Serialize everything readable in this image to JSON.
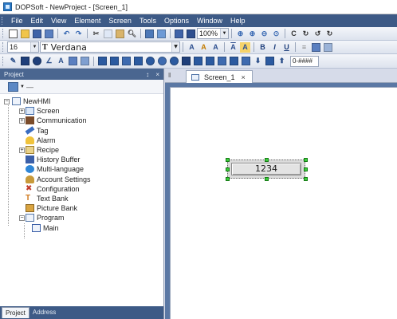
{
  "window": {
    "title": "DOPSoft - NewProject - [Screen_1]"
  },
  "menu": [
    "File",
    "Edit",
    "View",
    "Element",
    "Screen",
    "Tools",
    "Options",
    "Window",
    "Help"
  ],
  "toolbar": {
    "zoom": "100%",
    "font_size": "16",
    "font_name": "Verdana",
    "font_icon": "T",
    "format_value": "0-####",
    "text_buttons": {
      "btn1": "A",
      "btn2": "A",
      "btn3": "A",
      "btn4": "A",
      "btn5": "A",
      "bold": "B",
      "italic": "I",
      "underline": "U"
    }
  },
  "project_panel": {
    "title": "Project",
    "pin": "p",
    "close": "×",
    "tree": {
      "root": "NewHMI",
      "items": [
        {
          "label": "Screen",
          "icon": "screen-icon",
          "expandable": true
        },
        {
          "label": "Communication",
          "icon": "communication-icon",
          "expandable": true
        },
        {
          "label": "Tag",
          "icon": "tag-icon",
          "expandable": false
        },
        {
          "label": "Alarm",
          "icon": "alarm-icon",
          "expandable": false
        },
        {
          "label": "Recipe",
          "icon": "recipe-icon",
          "expandable": true
        },
        {
          "label": "History Buffer",
          "icon": "history-buffer-icon",
          "expandable": false
        },
        {
          "label": "Multi-language",
          "icon": "multi-language-icon",
          "expandable": false
        },
        {
          "label": "Account Settings",
          "icon": "account-settings-icon",
          "expandable": false
        },
        {
          "label": "Configuration",
          "icon": "configuration-icon",
          "expandable": false
        },
        {
          "label": "Text Bank",
          "icon": "text-bank-icon",
          "expandable": false
        },
        {
          "label": "Picture Bank",
          "icon": "picture-bank-icon",
          "expandable": false
        },
        {
          "label": "Program",
          "icon": "program-icon",
          "expandable": true
        }
      ],
      "program_children": [
        "Main"
      ]
    },
    "tabs": [
      "Project",
      "Address"
    ]
  },
  "document": {
    "tab_label": "Screen_1",
    "tab_close": "×",
    "numeric_display_value": "1234"
  }
}
